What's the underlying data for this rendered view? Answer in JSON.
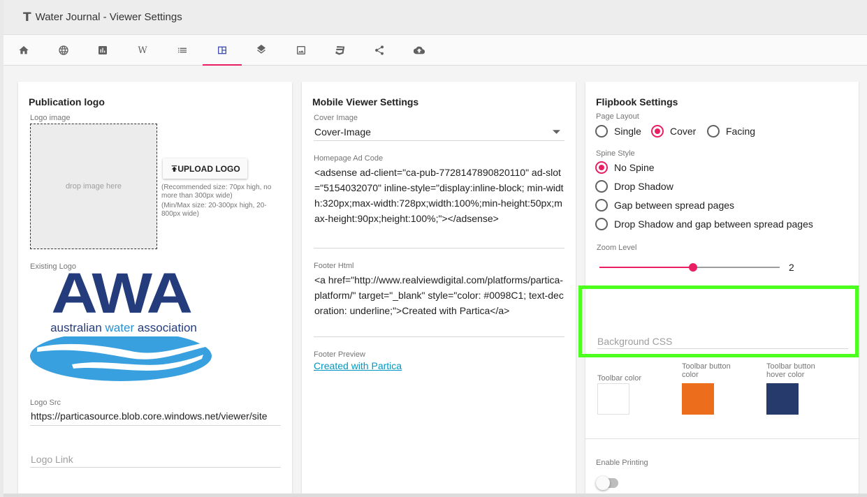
{
  "window": {
    "title": "Water Journal - Viewer Settings",
    "title_icon": "text-icon"
  },
  "tabs": [
    {
      "icon": "home-icon"
    },
    {
      "icon": "globe-icon"
    },
    {
      "icon": "chart-icon"
    },
    {
      "icon": "wikipedia-icon",
      "glyph": "W"
    },
    {
      "icon": "list-icon"
    },
    {
      "icon": "layout-icon",
      "active": true
    },
    {
      "icon": "layers-icon"
    },
    {
      "icon": "image-icon"
    },
    {
      "icon": "css-icon"
    },
    {
      "icon": "share-icon"
    },
    {
      "icon": "cloud-upload-icon"
    }
  ],
  "logo_card": {
    "title": "Publication logo",
    "logo_image_label": "Logo image",
    "drop_text": "drop image here",
    "upload_button": "UPLOAD LOGO",
    "hint1": "(Recommended size: 70px high, no more than 300px wide)",
    "hint2": "(Min/Max size: 20-300px high, 20-800px wide)",
    "existing_logo_label": "Existing Logo",
    "logo_text": "AWA",
    "logo_subtext_1": "australian ",
    "logo_subtext_2": "water",
    "logo_subtext_3": " association",
    "logo_src_label": "Logo Src",
    "logo_src_value": "https://particasource.blob.core.windows.net/viewer/site",
    "logo_link_placeholder": "Logo Link"
  },
  "mobile_card": {
    "title": "Mobile Viewer Settings",
    "cover_image_label": "Cover Image",
    "cover_image_value": "Cover-Image",
    "ad_code_label": "Homepage Ad Code",
    "ad_code_value": "<adsense ad-client=\"ca-pub-7728147890820110\" ad-slot=\"5154032070\" inline-style=\"display:inline-block; min-width:320px;max-width:728px;width:100%;min-height:50px;max-height:90px;height:100%;\"></adsense>",
    "footer_html_label": "Footer Html",
    "footer_html_value": "<a href=\"http://www.realviewdigital.com/platforms/partica-platform/\" target=\"_blank\" style=\"color: #0098C1; text-decoration: underline;\">Created with Partica</a>",
    "footer_preview_label": "Footer Preview",
    "footer_preview_link": "Created with Partica"
  },
  "flipbook_card": {
    "title": "Flipbook Settings",
    "page_layout_label": "Page Layout",
    "page_layout_options": [
      "Single",
      "Cover",
      "Facing"
    ],
    "page_layout_selected": "Cover",
    "spine_style_label": "Spine Style",
    "spine_options": [
      "No Spine",
      "Drop Shadow",
      "Gap between spread pages",
      "Drop Shadow and gap between spread pages"
    ],
    "spine_selected": "No Spine",
    "zoom_label": "Zoom Level",
    "zoom_value": "2",
    "zoom_fraction": 0.52,
    "background_css_placeholder": "Background CSS",
    "toolbar_color_label": "Toolbar color",
    "toolbar_button_color_label": "Toolbar button color",
    "toolbar_button_hover_label": "Toolbar button hover color",
    "enable_printing_label": "Enable Printing",
    "enable_printing": false
  },
  "colors": {
    "accent": "#e91e63",
    "tab_active": "#3f51b5",
    "toolbar_color": "#ffffff",
    "toolbar_button_color": "#ec6d1b",
    "toolbar_button_hover_color": "#263a6b",
    "link": "#0098c1",
    "highlight": "#4cff1f"
  }
}
